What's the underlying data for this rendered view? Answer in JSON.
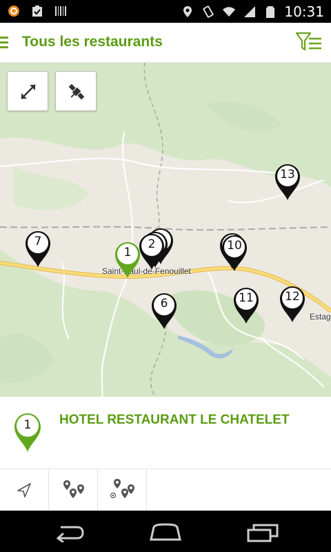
{
  "status_bar": {
    "time": "10:31",
    "left_icons": [
      "notification-app-icon",
      "task-check-icon",
      "barcode-icon"
    ],
    "right_icons": [
      "location-icon",
      "vibrate-icon",
      "wifi-icon",
      "signal-icon",
      "battery-icon"
    ]
  },
  "action_bar": {
    "menu_icon": "hamburger-menu-icon",
    "title": "Tous les restaurants",
    "filter_icon": "filter-list-icon"
  },
  "map": {
    "controls": [
      {
        "name": "fullscreen-expand",
        "icon": "expand-arrows-icon"
      },
      {
        "name": "satellite-view",
        "icon": "satellite-icon"
      }
    ],
    "place_labels": [
      "Saint-Paul-de-Fenouillet",
      "Estag"
    ],
    "markers": [
      {
        "label": "13",
        "selected": false
      },
      {
        "label": "7",
        "selected": false
      },
      {
        "label": "1",
        "selected": true
      },
      {
        "label": "",
        "selected": false
      },
      {
        "label": "",
        "selected": false
      },
      {
        "label": "2",
        "selected": false
      },
      {
        "label": "",
        "selected": false
      },
      {
        "label": "10",
        "selected": false
      },
      {
        "label": "6",
        "selected": false
      },
      {
        "label": "11",
        "selected": false
      },
      {
        "label": "12",
        "selected": false
      }
    ]
  },
  "selected_restaurant": {
    "marker_label": "1",
    "name": "HOTEL RESTAURANT LE CHATELET"
  },
  "toolbar": {
    "buttons": [
      {
        "name": "navigate",
        "icon": "navigation-arrow-icon"
      },
      {
        "name": "show-all-markers",
        "icon": "multiple-pins-icon"
      },
      {
        "name": "nearby-markers",
        "icon": "pins-around-location-icon"
      }
    ]
  },
  "nav_bar": {
    "icons": [
      "back-icon",
      "home-icon",
      "recent-apps-icon"
    ]
  },
  "colors": {
    "brand_green": "#5b9c12",
    "marker_green": "#62a81e",
    "marker_black": "#111111",
    "road_yellow": "#f6d86a"
  }
}
